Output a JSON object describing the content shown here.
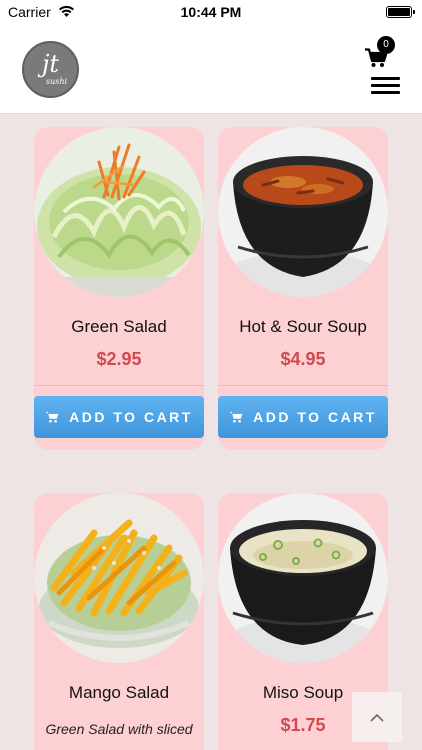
{
  "status_bar": {
    "carrier": "Carrier",
    "time": "10:44 PM"
  },
  "header": {
    "logo_mark": "jt",
    "logo_sub": "sushi",
    "cart_count": "0"
  },
  "products": [
    {
      "name": "Green Salad",
      "price": "$2.95",
      "button_label": "ADD TO CART",
      "image": "green-salad"
    },
    {
      "name": "Hot & Sour Soup",
      "price": "$4.95",
      "button_label": "ADD TO CART",
      "image": "hot-sour-soup"
    },
    {
      "name": "Mango Salad",
      "description": "Green Salad with sliced",
      "image": "mango-salad"
    },
    {
      "name": "Miso Soup",
      "price": "$1.75",
      "image": "miso-soup"
    }
  ],
  "icons": {
    "cart": "shopping-cart-icon",
    "menu": "hamburger-menu-icon",
    "scroll_top": "chevron-up-icon"
  },
  "colors": {
    "card_background": "#fdd1d4",
    "price": "#d14a4e",
    "button": "#4ea5e6",
    "page_background": "#efe4e4"
  }
}
